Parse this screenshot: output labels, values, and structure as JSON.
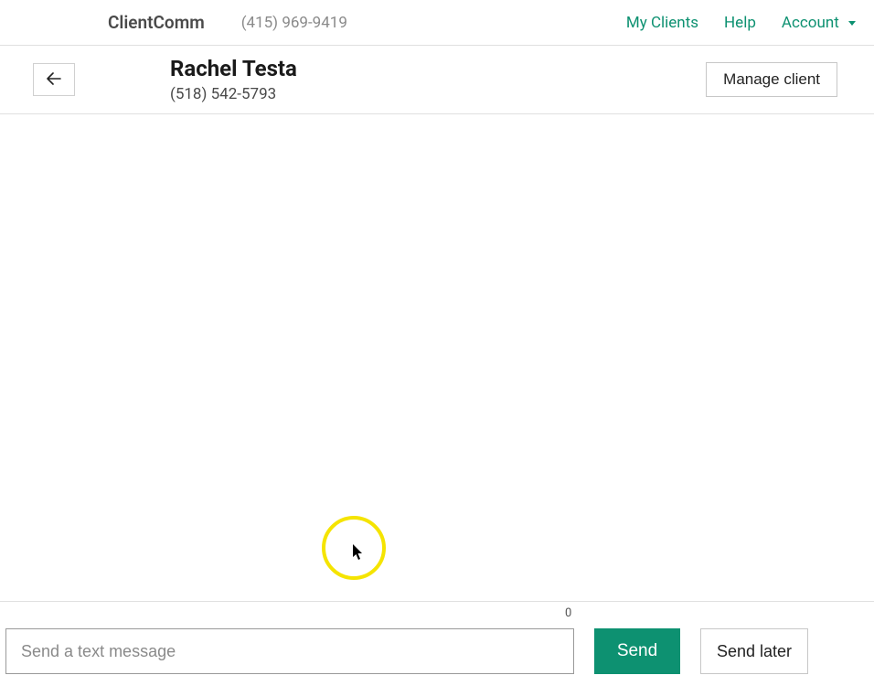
{
  "header": {
    "brand": "ClientComm",
    "brand_phone": "(415) 969-9419",
    "nav": {
      "my_clients": "My Clients",
      "help": "Help",
      "account": "Account"
    }
  },
  "client": {
    "name": "Rachel Testa",
    "phone": "(518) 542-5793",
    "manage_label": "Manage client"
  },
  "compose": {
    "placeholder": "Send a text message",
    "value": "",
    "char_count": "0",
    "send_label": "Send",
    "send_later_label": "Send later"
  }
}
